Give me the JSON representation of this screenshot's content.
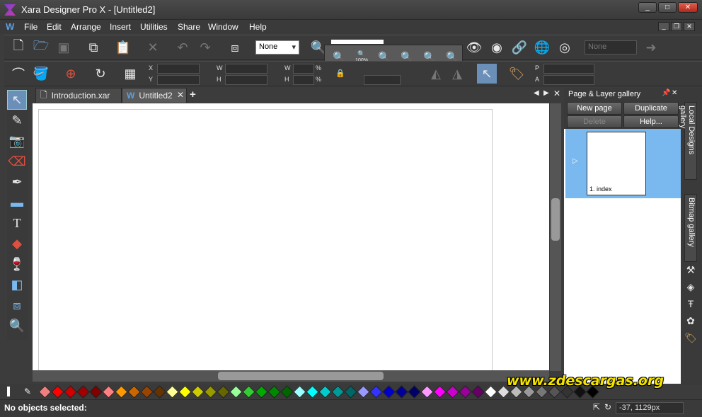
{
  "window": {
    "title": "Xara Designer Pro X - [Untitled2]",
    "minimize": "_",
    "maximize": "□",
    "close": "✕"
  },
  "menubar": {
    "logo": "W",
    "items": [
      "File",
      "Edit",
      "Arrange",
      "Insert",
      "Utilities",
      "Share",
      "Window",
      "Help"
    ]
  },
  "toolbar": {
    "quality_value": "None",
    "dim_combo_value": "None",
    "icons": [
      "new-document",
      "open-folder",
      "save",
      "copy",
      "paste",
      "delete",
      "undo",
      "redo",
      "transform",
      "zoom",
      "view",
      "view-outline",
      "link",
      "web-globe",
      "web-preview",
      "forward-arrow"
    ]
  },
  "zoom_popup": {
    "label_100": "100%"
  },
  "infobar": {
    "x_label": "X",
    "y_label": "Y",
    "w_label": "W",
    "h_label": "H",
    "w2_label": "W",
    "h2_label": "H",
    "pct1": "%",
    "pct2": "%",
    "p_label": "P",
    "a_label": "A"
  },
  "tabs": [
    {
      "label": "Introduction.xar",
      "active": false
    },
    {
      "label": "Untitled2",
      "active": true
    }
  ],
  "tab_add": "+",
  "gallery": {
    "title": "Page & Layer gallery",
    "buttons": {
      "new_page": "New page",
      "duplicate": "Duplicate",
      "delete": "Delete",
      "help": "Help..."
    },
    "page_caption": "1. index"
  },
  "side_galleries": [
    "Local Designs gallery",
    "Bitmap gallery"
  ],
  "palette_colors": [
    "#f08080",
    "#ff0000",
    "#d00000",
    "#a00000",
    "#800000",
    "#ff8080",
    "#ff9900",
    "#cc6600",
    "#994400",
    "#663300",
    "#ffff99",
    "#ffff00",
    "#cccc00",
    "#999900",
    "#666600",
    "#99ff99",
    "#33cc33",
    "#00aa00",
    "#008800",
    "#006600",
    "#99ffff",
    "#00ffff",
    "#00cccc",
    "#009999",
    "#006666",
    "#9999ff",
    "#3333ff",
    "#0000cc",
    "#000099",
    "#000066",
    "#ff99ff",
    "#ff00ff",
    "#cc00cc",
    "#990099",
    "#660066",
    "#ffffff",
    "#dddddd",
    "#bbbbbb",
    "#999999",
    "#777777",
    "#555555",
    "#333333",
    "#111111",
    "#000000"
  ],
  "watermark": "www.zdescargas.org",
  "status": {
    "message": "No objects selected:",
    "coords": "-37, 1129px"
  }
}
